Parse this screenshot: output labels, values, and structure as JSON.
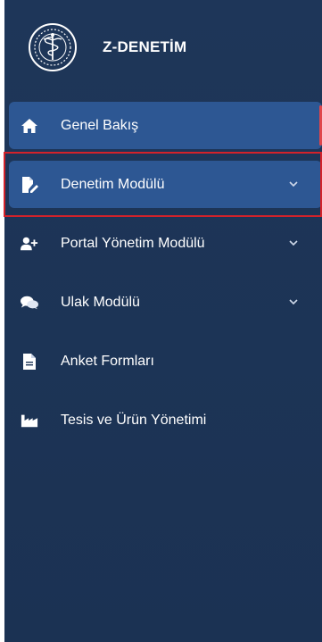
{
  "app": {
    "title": "Z-DENETİM",
    "logo_icon": "caduceus-seal-icon"
  },
  "colors": {
    "sidebar_bg": "#1d3557",
    "item_highlight": "#2d5793",
    "active_indicator": "#e0464b",
    "focus_outline": "#d3222a"
  },
  "nav": [
    {
      "label": "Genel Bakış",
      "icon": "home-icon",
      "has_chevron": false,
      "active": true
    },
    {
      "label": "Denetim Modülü",
      "icon": "file-signature-icon",
      "has_chevron": true,
      "highlighted": true
    },
    {
      "label": "Portal Yönetim Modülü",
      "icon": "user-plus-icon",
      "has_chevron": true
    },
    {
      "label": "Ulak Modülü",
      "icon": "comments-icon",
      "has_chevron": true
    },
    {
      "label": "Anket Formları",
      "icon": "file-text-icon",
      "has_chevron": false
    },
    {
      "label": "Tesis ve Ürün Yönetimi",
      "icon": "industry-icon",
      "has_chevron": false
    }
  ]
}
